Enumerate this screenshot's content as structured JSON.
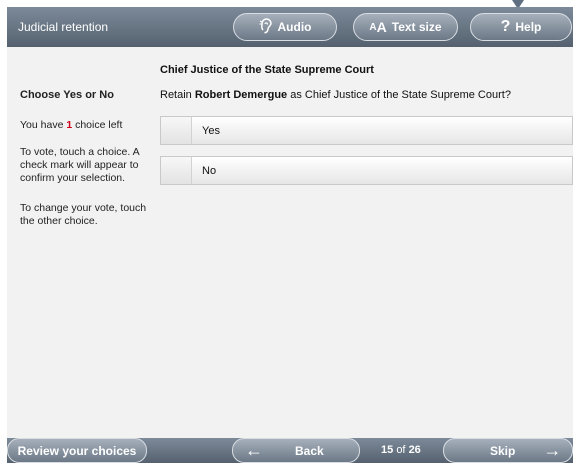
{
  "header": {
    "title": "Judicial retention",
    "audio_label": "Audio",
    "text_size_small": "A",
    "text_size_big": "A",
    "text_size_label": "Text size",
    "help_icon_glyph": "?",
    "help_label": "Help"
  },
  "instructions": {
    "heading": "Choose Yes or No",
    "choices_prefix": "You have",
    "choices_left": "1",
    "choices_suffix": "choice left",
    "vote_help": "To vote, touch a choice. A check mark will appear to confirm your selection.",
    "change_help": "To change your vote, touch the other choice."
  },
  "contest": {
    "title": "Chief Justice of the State Supreme Court",
    "question_prefix": "Retain",
    "candidate": "Robert Demergue",
    "question_suffix": "as Chief Justice of the State Supreme Court?",
    "options": [
      {
        "label": "Yes",
        "selected": false
      },
      {
        "label": "No",
        "selected": false
      }
    ]
  },
  "footer": {
    "review_label": "Review your choices",
    "back_label": "Back",
    "current_page": "15",
    "of_label": "of",
    "total_pages": "26",
    "skip_label": "Skip"
  },
  "icons": {
    "audio": "ear-icon",
    "help": "question-icon",
    "back": "arrow-left-icon",
    "skip": "arrow-right-icon"
  },
  "colors": {
    "bar": "#6a7684",
    "accent_count": "#d0021b",
    "background": "#f2f2f2"
  }
}
